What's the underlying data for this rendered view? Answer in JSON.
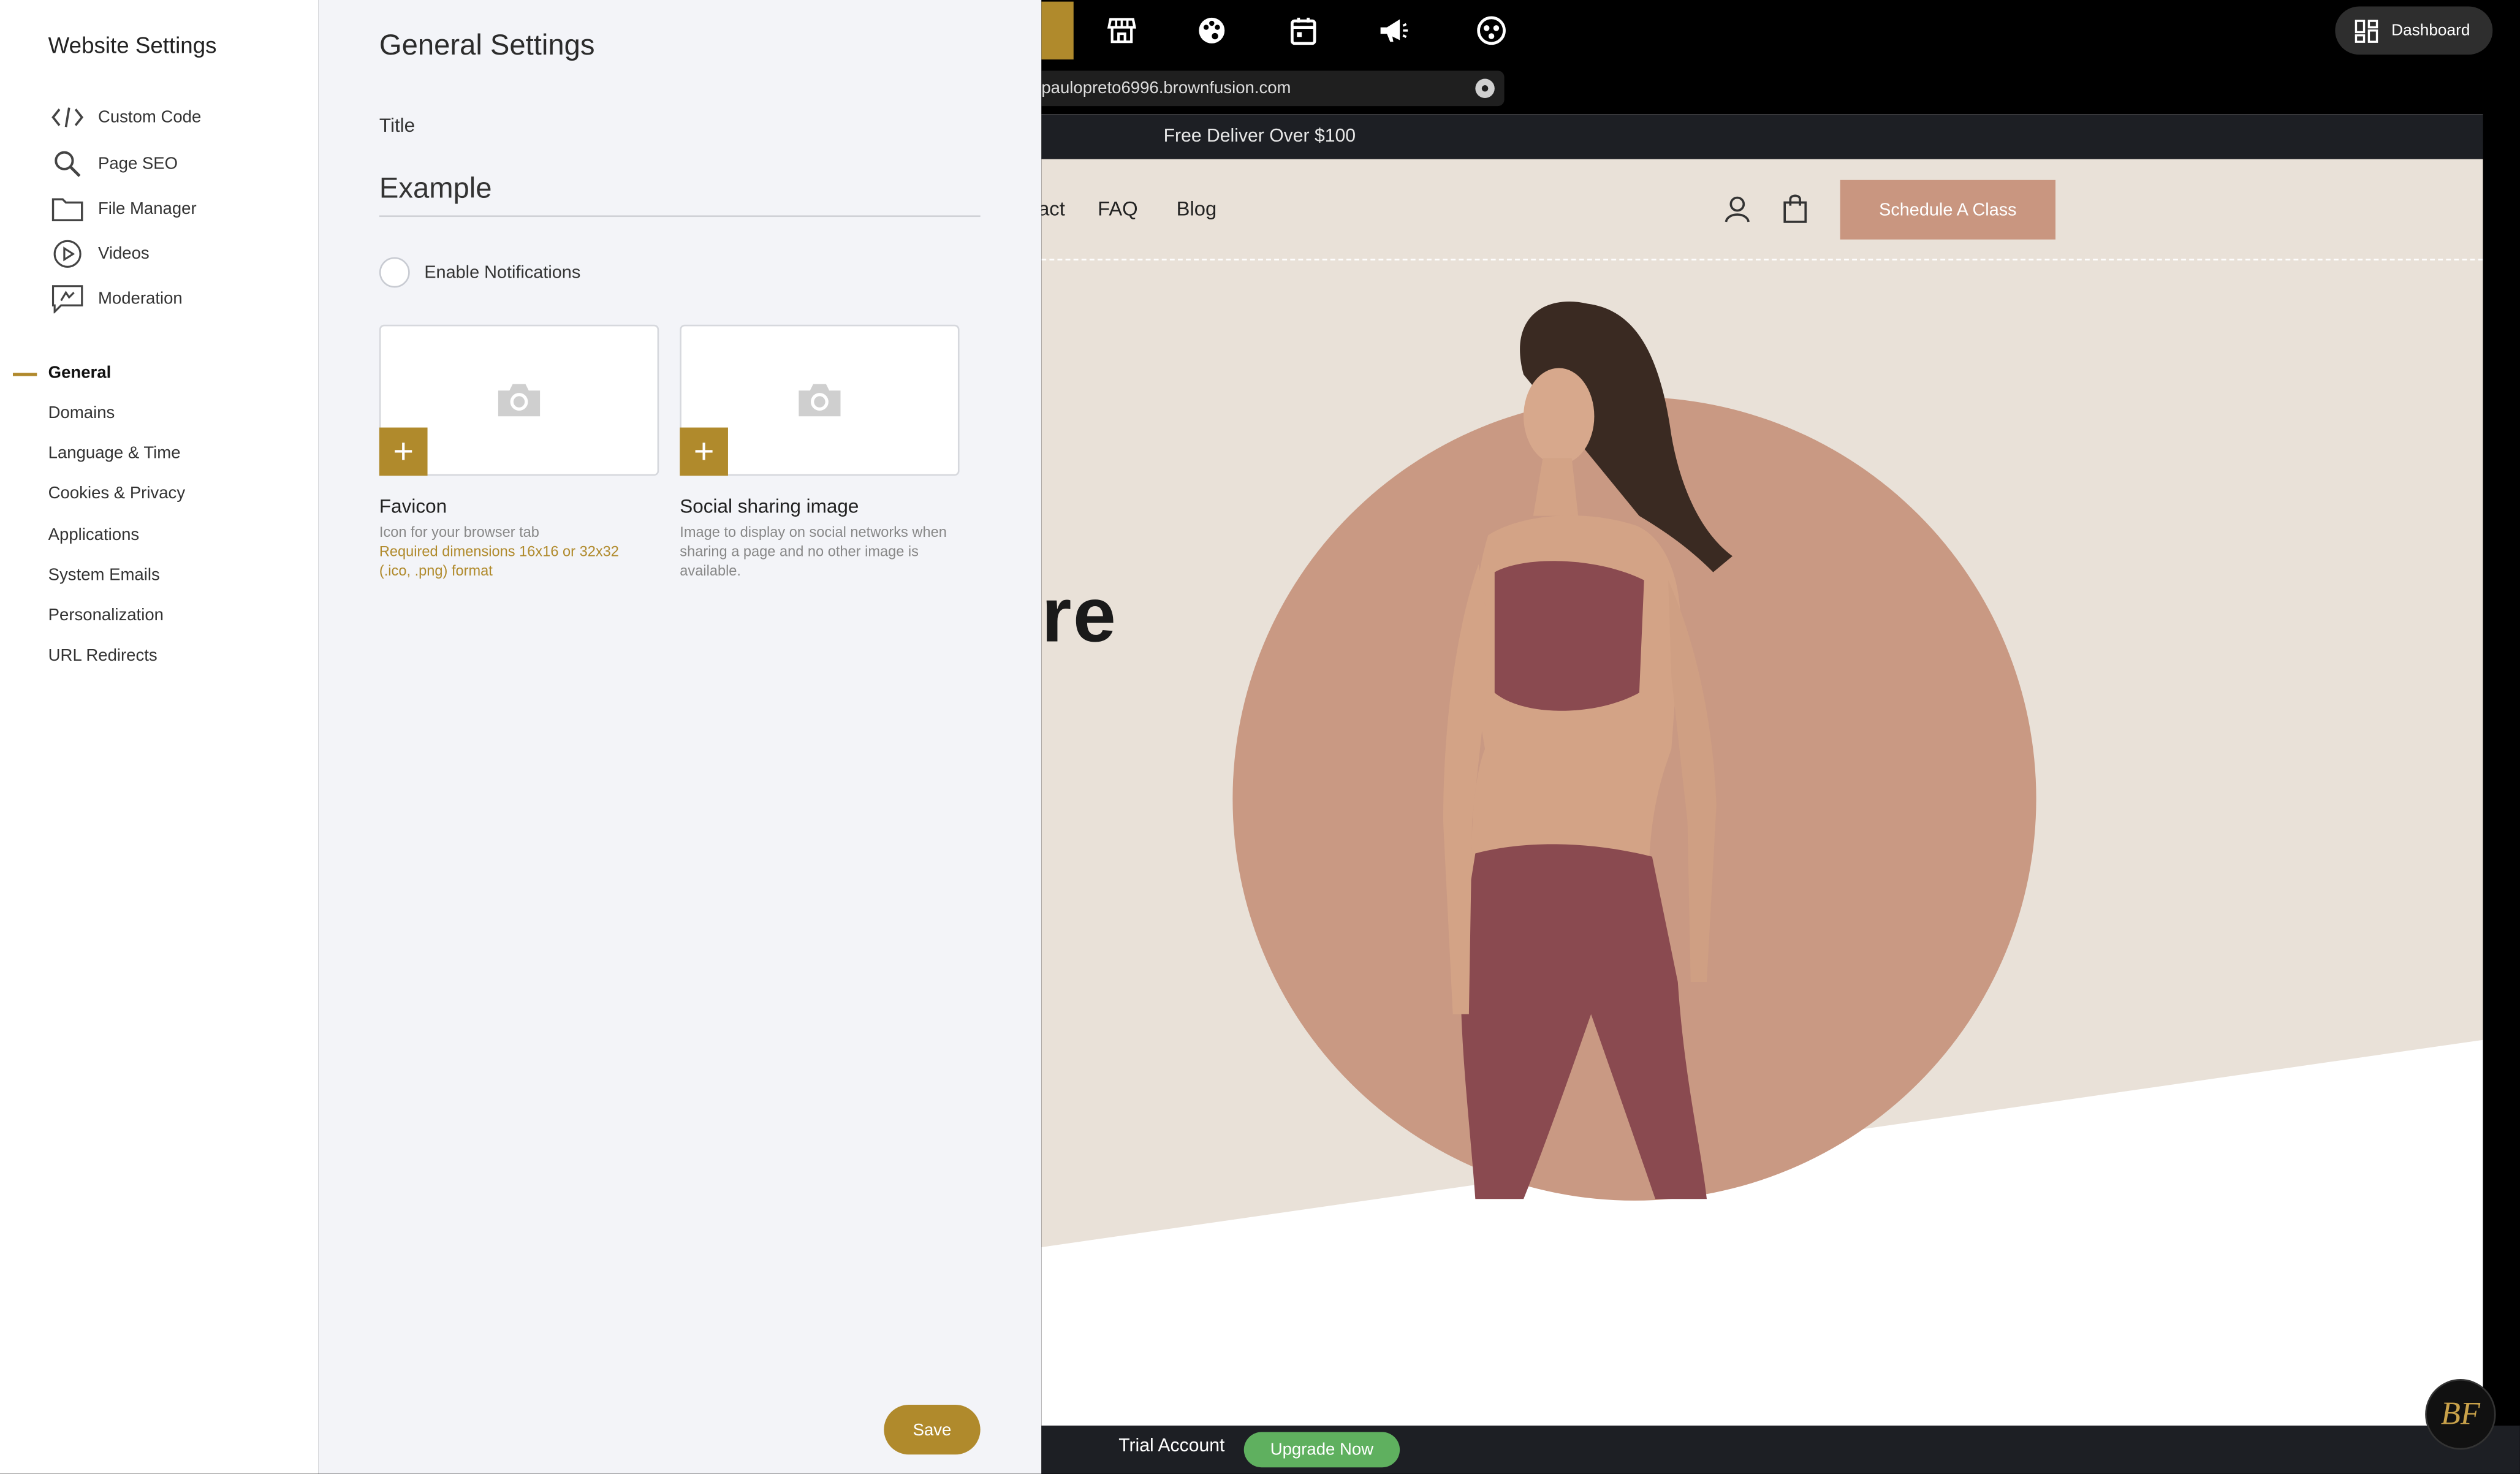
{
  "sidebar": {
    "title": "Website Settings",
    "tools": [
      {
        "label": "Custom Code",
        "icon": "code-icon"
      },
      {
        "label": "Page SEO",
        "icon": "search-icon"
      },
      {
        "label": "File Manager",
        "icon": "folder-icon"
      },
      {
        "label": "Videos",
        "icon": "play-icon"
      },
      {
        "label": "Moderation",
        "icon": "moderation-icon"
      }
    ],
    "nav": [
      {
        "label": "General",
        "active": true
      },
      {
        "label": "Domains"
      },
      {
        "label": "Language & Time"
      },
      {
        "label": "Cookies & Privacy"
      },
      {
        "label": "Applications"
      },
      {
        "label": "System Emails"
      },
      {
        "label": "Personalization"
      },
      {
        "label": "URL Redirects"
      }
    ],
    "accent_color": "#b0892c"
  },
  "panel": {
    "title": "General Settings",
    "title_field_label": "Title",
    "title_field_value": "Example",
    "notifications_label": "Enable Notifications",
    "notifications_enabled": false,
    "favicon": {
      "title": "Favicon",
      "desc": "Icon for your browser tab",
      "requirement": "Required dimensions 16x16 or 32x32 (.ico, .png) format"
    },
    "social": {
      "title": "Social sharing image",
      "desc": "Image to display on social networks when sharing a page and no other image is available."
    },
    "save_label": "Save"
  },
  "preview": {
    "dashboard_label": "Dashboard",
    "url": "paulopreto6996.brownfusion.com",
    "promo": "Free Deliver Over $100",
    "nav": [
      "act",
      "FAQ",
      "Blog"
    ],
    "cta": "Schedule A Class",
    "hero_text": "re",
    "trial_label": "Trial Account",
    "upgrade_label": "Upgrade Now",
    "logo_text": "BF",
    "colors": {
      "cta": "#c99680",
      "circle": "#c99983",
      "bg": "#e9e1d8",
      "upgrade": "#5fb05f"
    }
  }
}
